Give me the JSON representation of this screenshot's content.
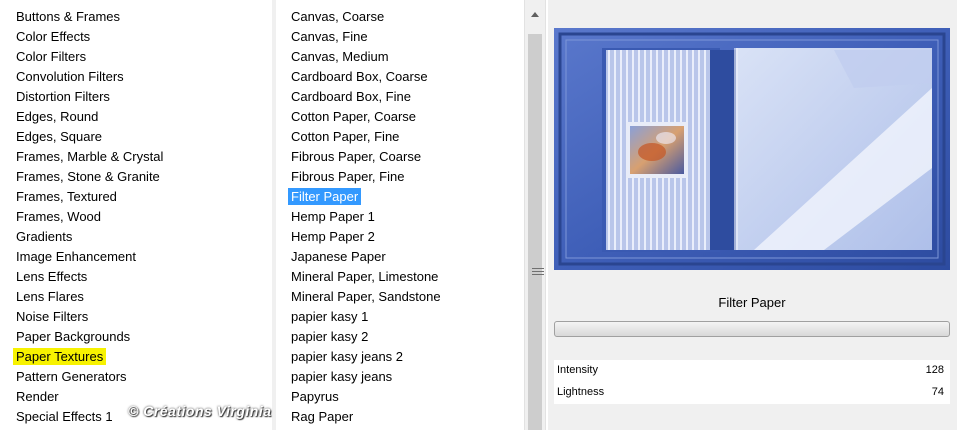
{
  "categories": {
    "items": [
      "Buttons & Frames",
      "Color Effects",
      "Color Filters",
      "Convolution Filters",
      "Distortion Filters",
      "Edges, Round",
      "Edges, Square",
      "Frames, Marble & Crystal",
      "Frames, Stone & Granite",
      "Frames, Textured",
      "Frames, Wood",
      "Gradients",
      "Image Enhancement",
      "Lens Effects",
      "Lens Flares",
      "Noise Filters",
      "Paper Backgrounds",
      "Paper Textures",
      "Pattern Generators",
      "Render",
      "Special Effects 1"
    ],
    "highlighted": "Paper Textures"
  },
  "filters": {
    "items": [
      "Canvas, Coarse",
      "Canvas, Fine",
      "Canvas, Medium",
      "Cardboard Box, Coarse",
      "Cardboard Box, Fine",
      "Cotton Paper, Coarse",
      "Cotton Paper, Fine",
      "Fibrous Paper, Coarse",
      "Fibrous Paper, Fine",
      "Filter Paper",
      "Hemp Paper 1",
      "Hemp Paper 2",
      "Japanese Paper",
      "Mineral Paper, Limestone",
      "Mineral Paper, Sandstone",
      "papier kasy 1",
      "papier kasy 2",
      "papier kasy jeans 2",
      "papier kasy jeans",
      "Papyrus",
      "Rag Paper"
    ],
    "selected": "Filter Paper"
  },
  "preview": {
    "filter_name": "Filter Paper",
    "params": [
      {
        "label": "Intensity",
        "value": "128"
      },
      {
        "label": "Lightness",
        "value": "74"
      }
    ],
    "watermark": "© Créations Virginia"
  },
  "colors": {
    "highlight": "#f7f200",
    "selection": "#3399ff",
    "frame_blue": "#3355a8"
  }
}
